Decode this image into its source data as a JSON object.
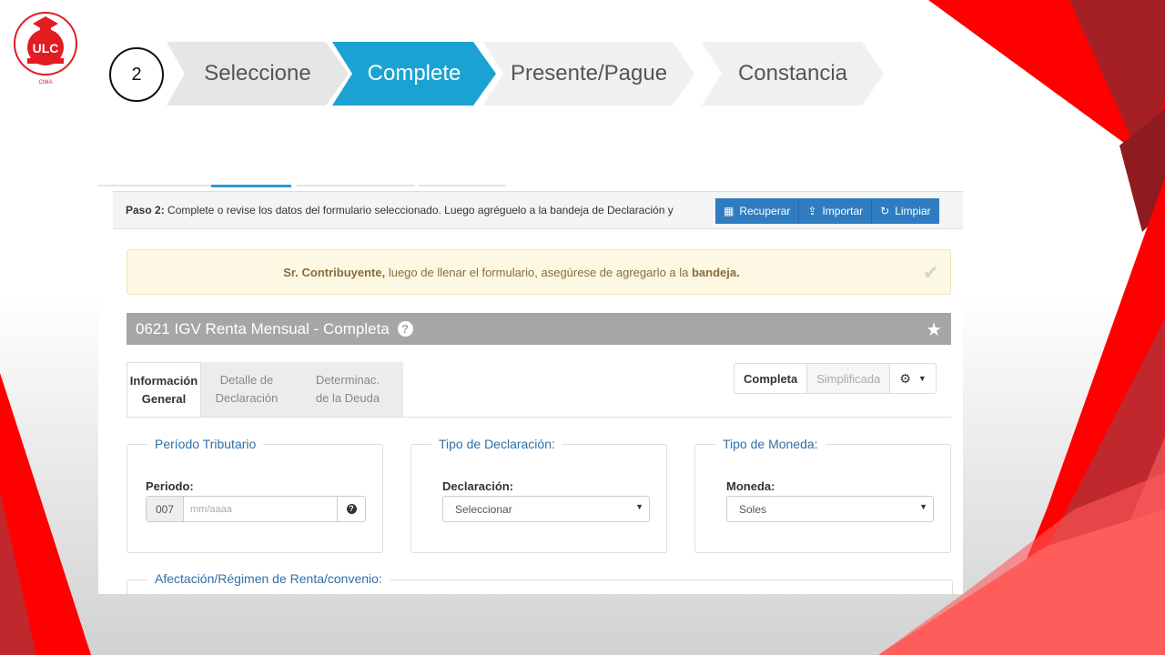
{
  "slide": {
    "logo_text": "ULC",
    "logo_ring_text": "UNIVERSIDAD LATINOAMERICANA",
    "logo_sub": "CIMA",
    "step_number": "2",
    "colors": {
      "red": "#ff0000",
      "dark_red": "#a52025",
      "accent_blue": "#1aa3d2"
    }
  },
  "wizard": {
    "steps": [
      {
        "label": "Seleccione",
        "state": "done"
      },
      {
        "label": "Complete",
        "state": "active"
      },
      {
        "label": "Presente/Pague",
        "state": "pending"
      },
      {
        "label": "Constancia",
        "state": "pending"
      }
    ]
  },
  "paso": {
    "prefix": "Paso 2:",
    "text": "Complete o revise los datos del formulario seleccionado. Luego agréguelo a la bandeja de Declaración y"
  },
  "toolbar": {
    "buttons": [
      {
        "label": "Recuperar",
        "icon": "calendar-icon"
      },
      {
        "label": "Importar",
        "icon": "upload-icon"
      },
      {
        "label": "Limpiar",
        "icon": "refresh-icon"
      }
    ]
  },
  "alert": {
    "strong": "Sr. Contribuyente,",
    "text": " luego de llenar el formulario, asegúrese de agregarlo a la ",
    "bold_end": "bandeja."
  },
  "form": {
    "title": "0621 IGV Renta Mensual - Completa",
    "tabs": [
      {
        "line1": "Información",
        "line2": "General",
        "active": true
      },
      {
        "line1": "Detalle de",
        "line2": "Declaración",
        "active": false
      },
      {
        "line1": "Determinac.",
        "line2": "de la Deuda",
        "active": false
      }
    ],
    "modes": {
      "complete": "Completa",
      "simplified": "Simplificada"
    }
  },
  "fieldsets": {
    "periodo": {
      "legend": "Período Tributario",
      "label": "Periodo:",
      "prefix": "007",
      "placeholder": "mm/aaaa"
    },
    "tipo_declaracion": {
      "legend": "Tipo de Declaración:",
      "label": "Declaración:",
      "selected": "Seleccionar"
    },
    "tipo_moneda": {
      "legend": "Tipo de Moneda:",
      "label": "Moneda:",
      "selected": "Soles"
    },
    "afectacion": {
      "legend": "Afectación/Régimen de Renta/convenio:"
    }
  }
}
